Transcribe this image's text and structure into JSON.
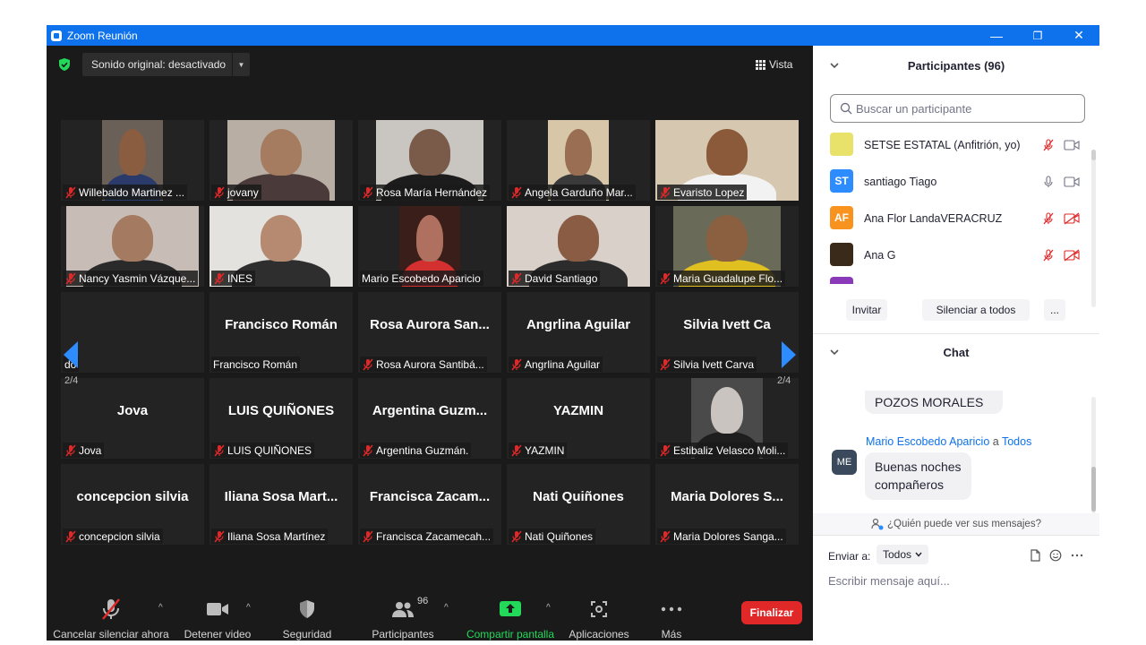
{
  "window": {
    "title": "Zoom Reunión",
    "minimize": "—",
    "restore": "❐",
    "close": "✕"
  },
  "top": {
    "sound": "Sonido original: desactivado",
    "view": "Vista"
  },
  "gallery": {
    "page": "2/4",
    "rows": [
      [
        {
          "name": "Willebaldo Martinez ...",
          "muted": true,
          "video": "#6b6058",
          "skin": "#8a5c40",
          "shirt": "#2a3a6a"
        },
        {
          "name": "jovany",
          "muted": true,
          "video": "#b9aea4",
          "skin": "#a67c60",
          "shirt": "#4a3a3a"
        },
        {
          "name": "Rosa María Hernández",
          "muted": true,
          "video": "#c9c5c0",
          "skin": "#7a5a48",
          "shirt": "#1c1c1c"
        },
        {
          "name": "Angela Garduño Mar...",
          "muted": true,
          "video": "#d7c7a8",
          "skin": "#9a6e52",
          "shirt": "#3a3a3a"
        },
        {
          "name": "Evaristo Lopez",
          "muted": true,
          "video": "#d6c8b0",
          "skin": "#8a5a3a",
          "shirt": "#f2f2f2"
        }
      ],
      [
        {
          "name": "Nancy Yasmin Vázque...",
          "muted": true,
          "video": "#c8bdb6",
          "skin": "#a47a60",
          "shirt": "#2a2a2a"
        },
        {
          "name": "INES",
          "muted": true,
          "video": "#e4e2de",
          "skin": "#b58a70",
          "shirt": "#2e2e2e"
        },
        {
          "name": "Mario Escobedo Aparicio",
          "muted": false,
          "video": "#3a1e1a",
          "skin": "#b07060",
          "shirt": "#d43030"
        },
        {
          "name": "David Santiago",
          "muted": true,
          "video": "#d9d0c9",
          "skin": "#8a5c44",
          "shirt": "#2c2c2c"
        },
        {
          "name": "Maria Guadalupe Flo...",
          "muted": true,
          "video": "#6a6a58",
          "skin": "#8a6040",
          "shirt": "#e0c020"
        }
      ],
      [
        {
          "name": "",
          "label": "do",
          "muted": false,
          "video": ""
        },
        {
          "name": "Francisco Román",
          "label": "Francisco Román",
          "muted": false,
          "video": ""
        },
        {
          "name": "Rosa Aurora San...",
          "label": "Rosa Aurora Santibá...",
          "muted": true,
          "video": ""
        },
        {
          "name": "Angrlina Aguilar",
          "label": "Angrlina Aguilar",
          "muted": true,
          "video": ""
        },
        {
          "name": "Silvia Ivett Ca",
          "label": "Silvia Ivett Carva",
          "muted": true,
          "video": ""
        }
      ],
      [
        {
          "name": "Jova",
          "label": "Jova",
          "muted": true,
          "video": ""
        },
        {
          "name": "LUIS QUIÑONES",
          "label": "LUIS QUIÑONES",
          "muted": true,
          "video": ""
        },
        {
          "name": "Argentina Guzm...",
          "label": "Argentina Guzmán.",
          "muted": true,
          "video": ""
        },
        {
          "name": "YAZMIN",
          "label": "YAZMIN",
          "muted": true,
          "video": ""
        },
        {
          "name": "",
          "label": "Estibaliz Velasco Moli...",
          "muted": true,
          "video": "#4a4a4a",
          "skin": "#c9c4c0",
          "shirt": "#1e1e1e"
        }
      ],
      [
        {
          "name": "concepcion silvia",
          "label": "concepcion silvia",
          "muted": true,
          "video": ""
        },
        {
          "name": "Iliana Sosa Mart...",
          "label": "Iliana Sosa Martínez",
          "muted": true,
          "video": ""
        },
        {
          "name": "Francisca Zacam...",
          "label": "Francisca Zacamecah...",
          "muted": true,
          "video": ""
        },
        {
          "name": "Nati Quiñones",
          "label": "Nati Quiñones",
          "muted": true,
          "video": ""
        },
        {
          "name": "Maria Dolores S...",
          "label": "Maria Dolores Sanga...",
          "muted": true,
          "video": ""
        }
      ]
    ]
  },
  "toolbar": {
    "mute": "Cancelar silenciar ahora",
    "video": "Detener video",
    "security": "Seguridad",
    "participants": "Participantes",
    "participants_count": "96",
    "share": "Compartir pantalla",
    "apps": "Aplicaciones",
    "more": "Más",
    "end": "Finalizar",
    "share_color": "#23d959",
    "end_color": "#e02828"
  },
  "participants": {
    "title": "Participantes (96)",
    "search_placeholder": "Buscar un participante",
    "list": [
      {
        "initials": "",
        "name": "SETSE ESTATAL (Anfitrión, yo)",
        "avatar": "#e8e26a",
        "mic": "muted",
        "cam": "on"
      },
      {
        "initials": "ST",
        "name": "santiago Tiago",
        "avatar": "#2d8cff",
        "mic": "on",
        "cam": "on"
      },
      {
        "initials": "AF",
        "name": "Ana Flor LandaVERACRUZ",
        "avatar": "#f7931e",
        "mic": "muted",
        "cam": "off"
      },
      {
        "initials": "",
        "name": "Ana G",
        "avatar": "#3a2a1a",
        "mic": "muted",
        "cam": "off"
      }
    ],
    "invite": "Invitar",
    "mute_all": "Silenciar a todos",
    "more": "..."
  },
  "chat": {
    "title": "Chat",
    "prev_message": "POZOS MORALES",
    "sender": "Mario Escobedo Aparicio",
    "to_word": "a",
    "recipient": "Todos",
    "sender_initials": "ME",
    "message": "Buenas noches compañeros",
    "who_can_see": "¿Quién puede ver sus mensajes?",
    "send_to_label": "Enviar a:",
    "send_to_value": "Todos",
    "placeholder": "Escribir mensaje aquí..."
  }
}
